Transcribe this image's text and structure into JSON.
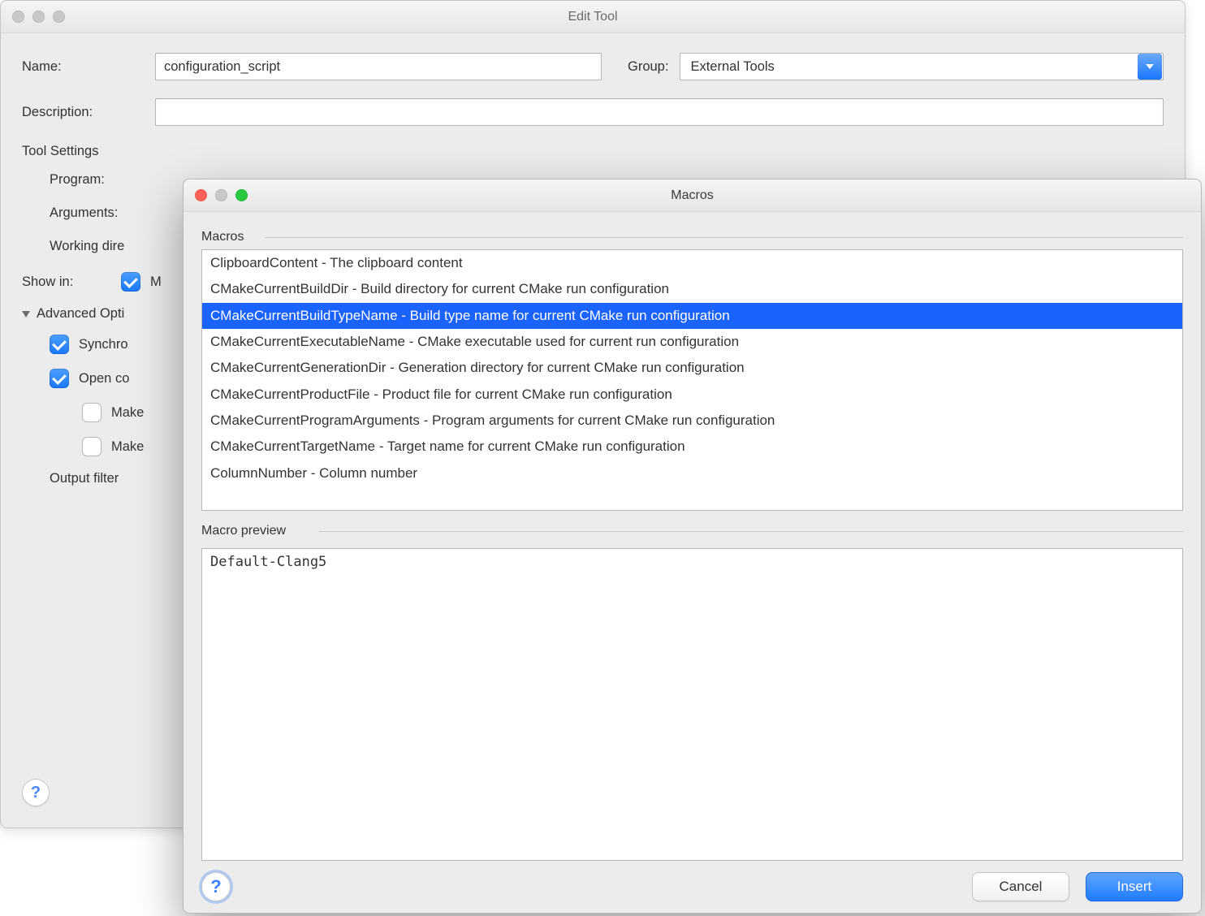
{
  "editTool": {
    "title": "Edit Tool",
    "labels": {
      "name": "Name:",
      "group": "Group:",
      "description": "Description:",
      "toolSettings": "Tool Settings",
      "program": "Program:",
      "arguments": "Arguments:",
      "workingDir": "Working dire",
      "showIn": "Show in:",
      "advancedOptions": "Advanced Opti",
      "outputFilter": "Output filter"
    },
    "name_value": "configuration_script",
    "group_value": "External Tools",
    "description_value": "",
    "showIn_first_partial": "M",
    "advanced": {
      "synchronize_checked": true,
      "synchronize_partial": "Synchro",
      "openConsole_checked": true,
      "openConsole_partial": "Open co",
      "make1_checked": false,
      "make1_partial": "Make",
      "make2_checked": false,
      "make2_partial": "Make"
    }
  },
  "macros": {
    "title": "Macros",
    "list_label": "Macros",
    "preview_label": "Macro preview",
    "items": [
      {
        "text": "ClipboardContent - The clipboard content",
        "selected": false
      },
      {
        "text": "CMakeCurrentBuildDir - Build directory for current CMake run configuration",
        "selected": false
      },
      {
        "text": "CMakeCurrentBuildTypeName - Build type name for current CMake run configuration",
        "selected": true
      },
      {
        "text": "CMakeCurrentExecutableName - CMake executable used for current run configuration",
        "selected": false
      },
      {
        "text": "CMakeCurrentGenerationDir - Generation directory for current CMake run configuration",
        "selected": false
      },
      {
        "text": "CMakeCurrentProductFile - Product file for current CMake run configuration",
        "selected": false
      },
      {
        "text": "CMakeCurrentProgramArguments - Program arguments for current CMake run configuration",
        "selected": false
      },
      {
        "text": "CMakeCurrentTargetName - Target name for current CMake run configuration",
        "selected": false
      },
      {
        "text": "ColumnNumber - Column number",
        "selected": false
      }
    ],
    "preview_value": "Default-Clang5",
    "buttons": {
      "cancel": "Cancel",
      "insert": "Insert"
    }
  }
}
